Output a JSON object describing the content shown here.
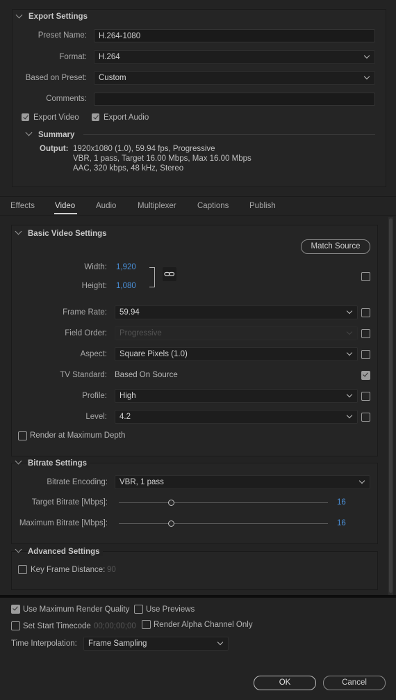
{
  "export_settings": {
    "title": "Export Settings",
    "preset_name_label": "Preset Name:",
    "preset_name_value": "H.264-1080",
    "format_label": "Format:",
    "format_value": "H.264",
    "based_on_preset_label": "Based on Preset:",
    "based_on_preset_value": "Custom",
    "comments_label": "Comments:",
    "comments_value": "",
    "export_video_label": "Export Video",
    "export_video_checked": true,
    "export_audio_label": "Export Audio",
    "export_audio_checked": true,
    "summary": {
      "title": "Summary",
      "output_label": "Output:",
      "lines": [
        "1920x1080 (1.0), 59.94 fps, Progressive",
        "VBR, 1 pass, Target 16.00 Mbps, Max 16.00 Mbps",
        "AAC, 320 kbps, 48 kHz, Stereo"
      ]
    }
  },
  "tabs": [
    "Effects",
    "Video",
    "Audio",
    "Multiplexer",
    "Captions",
    "Publish"
  ],
  "active_tab": "Video",
  "basic_video": {
    "title": "Basic Video Settings",
    "match_source_label": "Match Source",
    "width_label": "Width:",
    "width_value": "1,920",
    "height_label": "Height:",
    "height_value": "1,080",
    "frame_rate_label": "Frame Rate:",
    "frame_rate_value": "59.94",
    "field_order_label": "Field Order:",
    "field_order_value": "Progressive",
    "aspect_label": "Aspect:",
    "aspect_value": "Square Pixels (1.0)",
    "tv_standard_label": "TV Standard:",
    "tv_standard_value": "Based On Source",
    "profile_label": "Profile:",
    "profile_value": "High",
    "level_label": "Level:",
    "level_value": "4.2",
    "render_max_depth_label": "Render at Maximum Depth"
  },
  "bitrate": {
    "title": "Bitrate Settings",
    "encoding_label": "Bitrate Encoding:",
    "encoding_value": "VBR, 1 pass",
    "target_label": "Target Bitrate [Mbps]:",
    "target_value": "16",
    "max_label": "Maximum Bitrate [Mbps]:",
    "max_value": "16"
  },
  "advanced": {
    "title": "Advanced Settings",
    "key_frame_label": "Key Frame Distance:",
    "key_frame_value": "90"
  },
  "bottom": {
    "use_max_render_label": "Use Maximum Render Quality",
    "use_previews_label": "Use Previews",
    "set_start_tc_label": "Set Start Timecode",
    "start_tc_value": "00;00;00;00",
    "render_alpha_label": "Render Alpha Channel Only",
    "time_interp_label": "Time Interpolation:",
    "time_interp_value": "Frame Sampling",
    "ok_label": "OK",
    "cancel_label": "Cancel"
  }
}
